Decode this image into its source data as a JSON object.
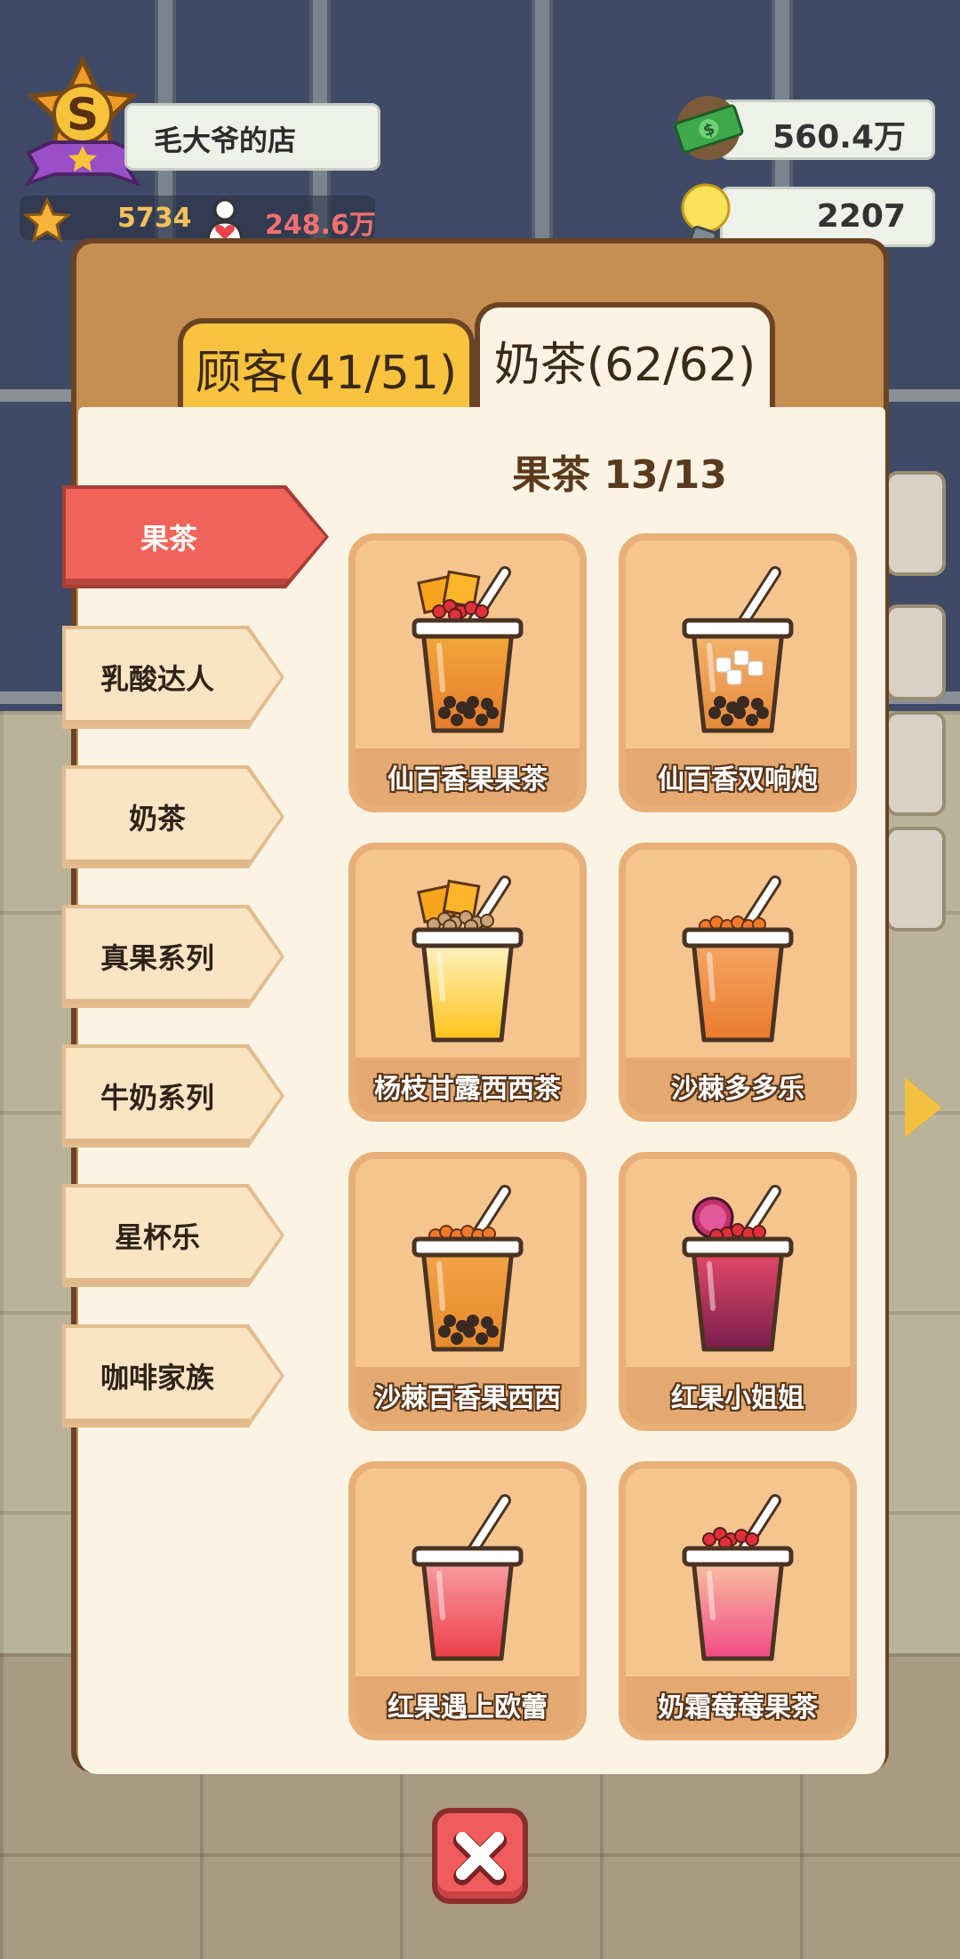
{
  "hud": {
    "rank_letter": "S",
    "shop_name": "毛大爷的店",
    "stars": "5734",
    "fans": "248.6万",
    "money": "560.4万",
    "ideas": "2207"
  },
  "tabs": [
    {
      "label": "顾客(41/51)",
      "active": false
    },
    {
      "label": "奶茶(62/62)",
      "active": true
    }
  ],
  "category_title": "果茶 13/13",
  "categories": [
    {
      "label": "果茶",
      "active": true
    },
    {
      "label": "乳酸达人",
      "active": false
    },
    {
      "label": "奶茶",
      "active": false
    },
    {
      "label": "真果系列",
      "active": false
    },
    {
      "label": "牛奶系列",
      "active": false
    },
    {
      "label": "星杯乐",
      "active": false
    },
    {
      "label": "咖啡家族",
      "active": false
    }
  ],
  "drinks": [
    {
      "name": "仙百香果果茶",
      "top": "#f3a93b",
      "bottom": "#e47b2e",
      "topping": "mango-berry",
      "pearls": true
    },
    {
      "name": "仙百香双响炮",
      "top": "#f4b46d",
      "bottom": "#e58a3a",
      "topping": "none",
      "pearls": true
    },
    {
      "name": "杨枝甘露西西茶",
      "top": "#fff4c8",
      "bottom": "#ffc21a",
      "topping": "mango-sago",
      "pearls": false
    },
    {
      "name": "沙棘多多乐",
      "top": "#f4a766",
      "bottom": "#ea7b2c",
      "topping": "orange-beads",
      "pearls": false
    },
    {
      "name": "沙棘百香果西西",
      "top": "#f2a347",
      "bottom": "#e68a2c",
      "topping": "orange-beads",
      "pearls": true
    },
    {
      "name": "红果小姐姐",
      "top": "#e84a6a",
      "bottom": "#7a1f4e",
      "topping": "dragonfruit",
      "pearls": false
    },
    {
      "name": "红果遇上欧蕾",
      "top": "#f7a0a4",
      "bottom": "#ec3f48",
      "topping": "none",
      "pearls": false
    },
    {
      "name": "奶霜莓莓果茶",
      "top": "#f8c4a0",
      "bottom": "#f04a86",
      "topping": "red-beads",
      "pearls": false
    }
  ],
  "colors": {
    "active_category": "#f0645a",
    "card_bg": "#f6c48f",
    "panel_border": "#6b4424",
    "close_button": "#f05b5b"
  }
}
